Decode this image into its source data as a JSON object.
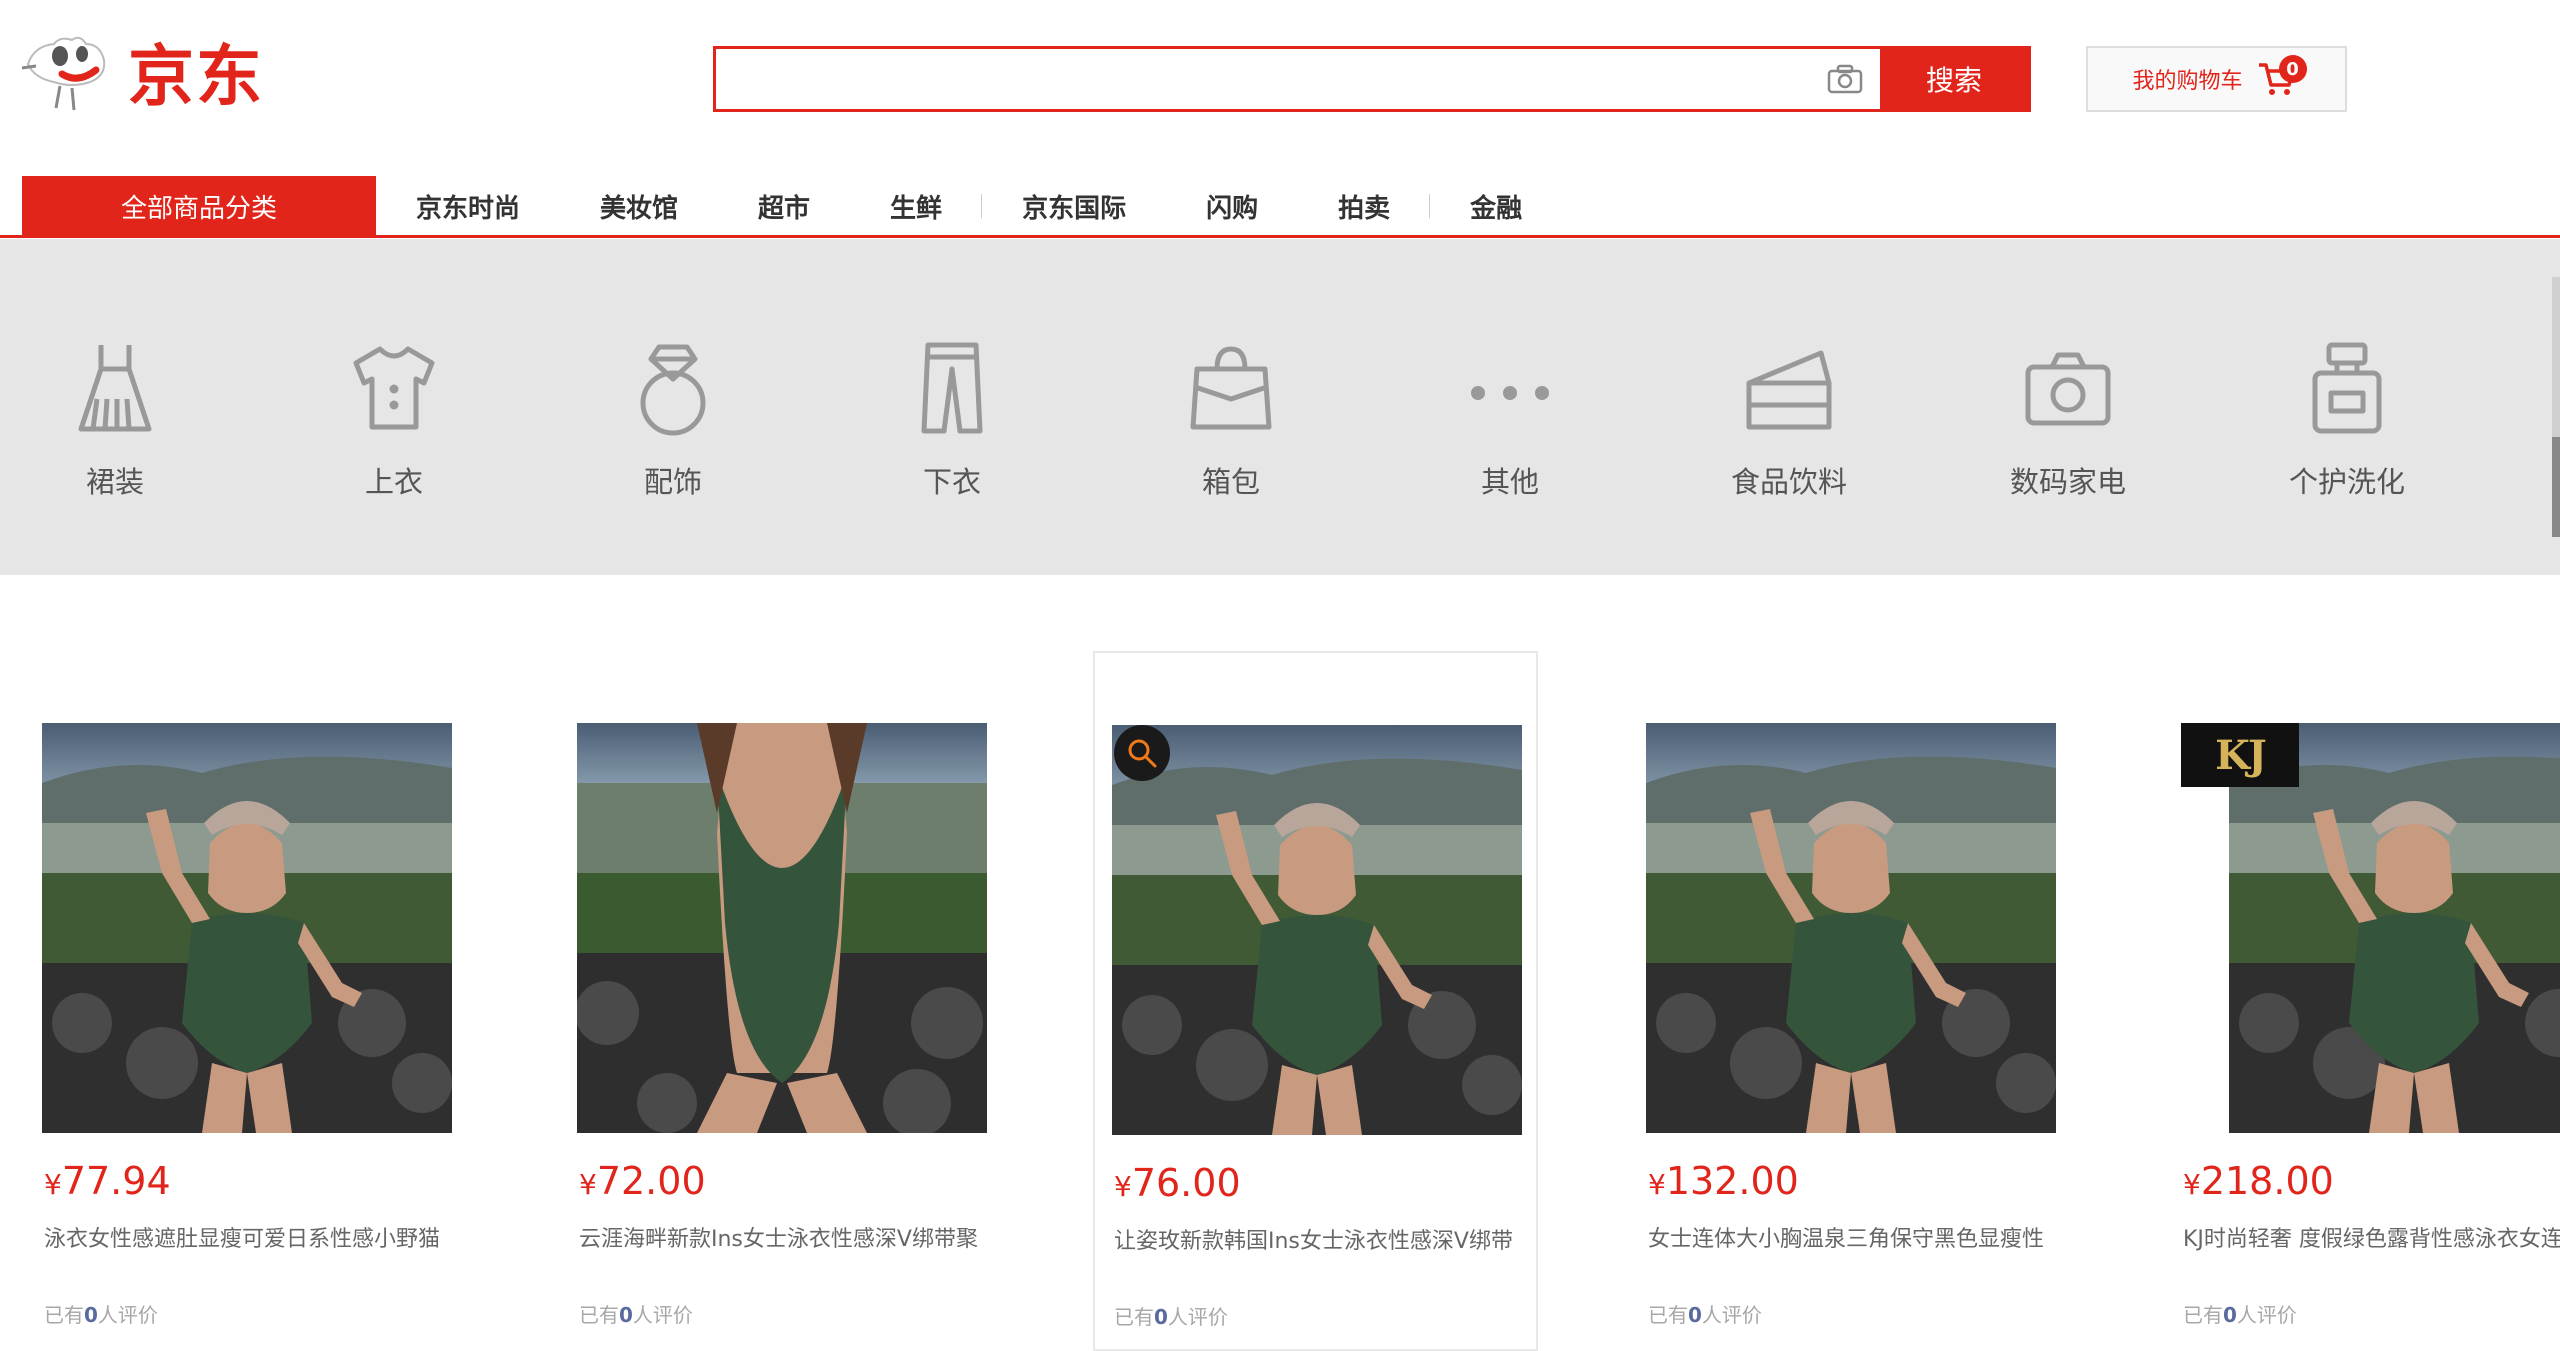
{
  "header": {
    "logo_text": "京东",
    "search": {
      "placeholder": "",
      "button_label": "搜索"
    },
    "cart": {
      "label": "我的购物车",
      "count": "0"
    }
  },
  "nav": {
    "all_label": "全部商品分类",
    "items": [
      "京东时尚",
      "美妆馆",
      "超市",
      "生鲜",
      "京东国际",
      "闪购",
      "拍卖",
      "金融"
    ]
  },
  "categories": [
    "裙装",
    "上衣",
    "配饰",
    "下衣",
    "箱包",
    "其他",
    "食品饮料",
    "数码家电",
    "个护洗化"
  ],
  "products": [
    {
      "price": "77.94",
      "title": "泳衣女性感遮肚显瘦可爱日系性感小野猫",
      "reviews_prefix": "已有",
      "reviews_count": "0",
      "reviews_suffix": "人评价"
    },
    {
      "price": "72.00",
      "title": "云涯海畔新款Ins女士泳衣性感深V绑带聚",
      "reviews_prefix": "已有",
      "reviews_count": "0",
      "reviews_suffix": "人评价"
    },
    {
      "price": "76.00",
      "title": "让姿玫新款韩国Ins女士泳衣性感深V绑带",
      "reviews_prefix": "已有",
      "reviews_count": "0",
      "reviews_suffix": "人评价"
    },
    {
      "price": "132.00",
      "title": "女士连体大小胸温泉三角保守黑色显瘦性",
      "reviews_prefix": "已有",
      "reviews_count": "0",
      "reviews_suffix": "人评价"
    },
    {
      "price": "218.00",
      "title": "KJ时尚轻奢 度假绿色露背性感泳衣女连",
      "reviews_prefix": "已有",
      "reviews_count": "0",
      "reviews_suffix": "人评价",
      "badge": "KJ"
    }
  ],
  "currency": "¥",
  "colors": {
    "brand": "#e1251b",
    "catbar": "#e6e6e6"
  }
}
